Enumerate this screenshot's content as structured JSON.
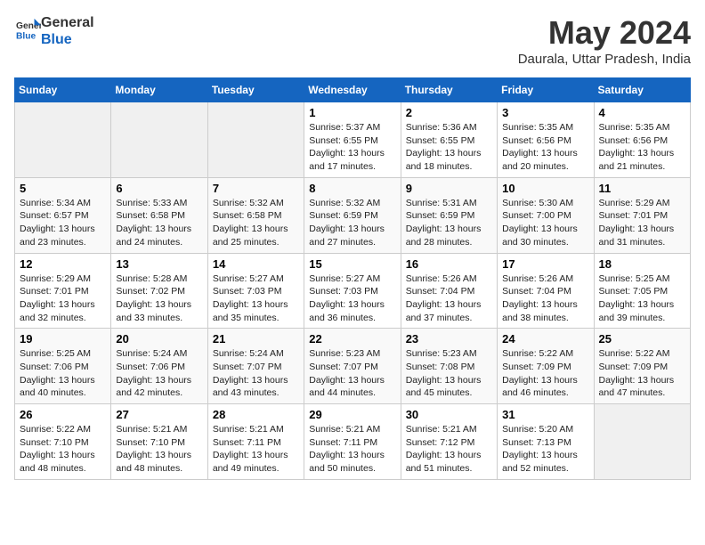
{
  "header": {
    "logo_general": "General",
    "logo_blue": "Blue",
    "title": "May 2024",
    "subtitle": "Daurala, Uttar Pradesh, India"
  },
  "calendar": {
    "days_of_week": [
      "Sunday",
      "Monday",
      "Tuesday",
      "Wednesday",
      "Thursday",
      "Friday",
      "Saturday"
    ],
    "weeks": [
      {
        "days": [
          {
            "number": "",
            "info": ""
          },
          {
            "number": "",
            "info": ""
          },
          {
            "number": "",
            "info": ""
          },
          {
            "number": "1",
            "info": "Sunrise: 5:37 AM\nSunset: 6:55 PM\nDaylight: 13 hours\nand 17 minutes."
          },
          {
            "number": "2",
            "info": "Sunrise: 5:36 AM\nSunset: 6:55 PM\nDaylight: 13 hours\nand 18 minutes."
          },
          {
            "number": "3",
            "info": "Sunrise: 5:35 AM\nSunset: 6:56 PM\nDaylight: 13 hours\nand 20 minutes."
          },
          {
            "number": "4",
            "info": "Sunrise: 5:35 AM\nSunset: 6:56 PM\nDaylight: 13 hours\nand 21 minutes."
          }
        ]
      },
      {
        "days": [
          {
            "number": "5",
            "info": "Sunrise: 5:34 AM\nSunset: 6:57 PM\nDaylight: 13 hours\nand 23 minutes."
          },
          {
            "number": "6",
            "info": "Sunrise: 5:33 AM\nSunset: 6:58 PM\nDaylight: 13 hours\nand 24 minutes."
          },
          {
            "number": "7",
            "info": "Sunrise: 5:32 AM\nSunset: 6:58 PM\nDaylight: 13 hours\nand 25 minutes."
          },
          {
            "number": "8",
            "info": "Sunrise: 5:32 AM\nSunset: 6:59 PM\nDaylight: 13 hours\nand 27 minutes."
          },
          {
            "number": "9",
            "info": "Sunrise: 5:31 AM\nSunset: 6:59 PM\nDaylight: 13 hours\nand 28 minutes."
          },
          {
            "number": "10",
            "info": "Sunrise: 5:30 AM\nSunset: 7:00 PM\nDaylight: 13 hours\nand 30 minutes."
          },
          {
            "number": "11",
            "info": "Sunrise: 5:29 AM\nSunset: 7:01 PM\nDaylight: 13 hours\nand 31 minutes."
          }
        ]
      },
      {
        "days": [
          {
            "number": "12",
            "info": "Sunrise: 5:29 AM\nSunset: 7:01 PM\nDaylight: 13 hours\nand 32 minutes."
          },
          {
            "number": "13",
            "info": "Sunrise: 5:28 AM\nSunset: 7:02 PM\nDaylight: 13 hours\nand 33 minutes."
          },
          {
            "number": "14",
            "info": "Sunrise: 5:27 AM\nSunset: 7:03 PM\nDaylight: 13 hours\nand 35 minutes."
          },
          {
            "number": "15",
            "info": "Sunrise: 5:27 AM\nSunset: 7:03 PM\nDaylight: 13 hours\nand 36 minutes."
          },
          {
            "number": "16",
            "info": "Sunrise: 5:26 AM\nSunset: 7:04 PM\nDaylight: 13 hours\nand 37 minutes."
          },
          {
            "number": "17",
            "info": "Sunrise: 5:26 AM\nSunset: 7:04 PM\nDaylight: 13 hours\nand 38 minutes."
          },
          {
            "number": "18",
            "info": "Sunrise: 5:25 AM\nSunset: 7:05 PM\nDaylight: 13 hours\nand 39 minutes."
          }
        ]
      },
      {
        "days": [
          {
            "number": "19",
            "info": "Sunrise: 5:25 AM\nSunset: 7:06 PM\nDaylight: 13 hours\nand 40 minutes."
          },
          {
            "number": "20",
            "info": "Sunrise: 5:24 AM\nSunset: 7:06 PM\nDaylight: 13 hours\nand 42 minutes."
          },
          {
            "number": "21",
            "info": "Sunrise: 5:24 AM\nSunset: 7:07 PM\nDaylight: 13 hours\nand 43 minutes."
          },
          {
            "number": "22",
            "info": "Sunrise: 5:23 AM\nSunset: 7:07 PM\nDaylight: 13 hours\nand 44 minutes."
          },
          {
            "number": "23",
            "info": "Sunrise: 5:23 AM\nSunset: 7:08 PM\nDaylight: 13 hours\nand 45 minutes."
          },
          {
            "number": "24",
            "info": "Sunrise: 5:22 AM\nSunset: 7:09 PM\nDaylight: 13 hours\nand 46 minutes."
          },
          {
            "number": "25",
            "info": "Sunrise: 5:22 AM\nSunset: 7:09 PM\nDaylight: 13 hours\nand 47 minutes."
          }
        ]
      },
      {
        "days": [
          {
            "number": "26",
            "info": "Sunrise: 5:22 AM\nSunset: 7:10 PM\nDaylight: 13 hours\nand 48 minutes."
          },
          {
            "number": "27",
            "info": "Sunrise: 5:21 AM\nSunset: 7:10 PM\nDaylight: 13 hours\nand 48 minutes."
          },
          {
            "number": "28",
            "info": "Sunrise: 5:21 AM\nSunset: 7:11 PM\nDaylight: 13 hours\nand 49 minutes."
          },
          {
            "number": "29",
            "info": "Sunrise: 5:21 AM\nSunset: 7:11 PM\nDaylight: 13 hours\nand 50 minutes."
          },
          {
            "number": "30",
            "info": "Sunrise: 5:21 AM\nSunset: 7:12 PM\nDaylight: 13 hours\nand 51 minutes."
          },
          {
            "number": "31",
            "info": "Sunrise: 5:20 AM\nSunset: 7:13 PM\nDaylight: 13 hours\nand 52 minutes."
          },
          {
            "number": "",
            "info": ""
          }
        ]
      }
    ]
  }
}
